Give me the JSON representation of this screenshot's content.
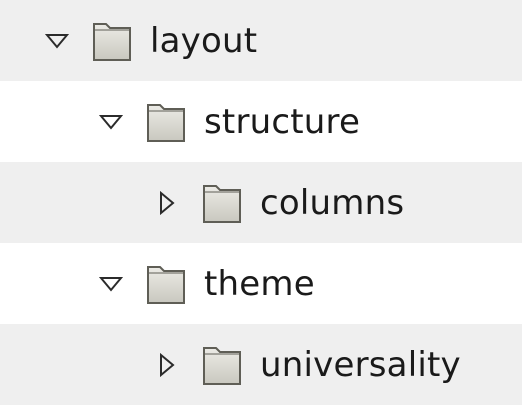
{
  "tree": {
    "items": [
      {
        "label": "layout",
        "state": "expanded",
        "icon": "folder-icon"
      },
      {
        "label": "structure",
        "state": "expanded",
        "icon": "folder-icon"
      },
      {
        "label": "columns",
        "state": "collapsed",
        "icon": "folder-icon"
      },
      {
        "label": "theme",
        "state": "expanded",
        "icon": "folder-icon"
      },
      {
        "label": "universality",
        "state": "collapsed",
        "icon": "folder-icon"
      }
    ]
  },
  "colors": {
    "row_alt": "#efefef",
    "row_plain": "#ffffff",
    "folder_fill": "#d6d5cf",
    "folder_stroke": "#5f5e56",
    "expander_stroke": "#2b2b2b"
  }
}
